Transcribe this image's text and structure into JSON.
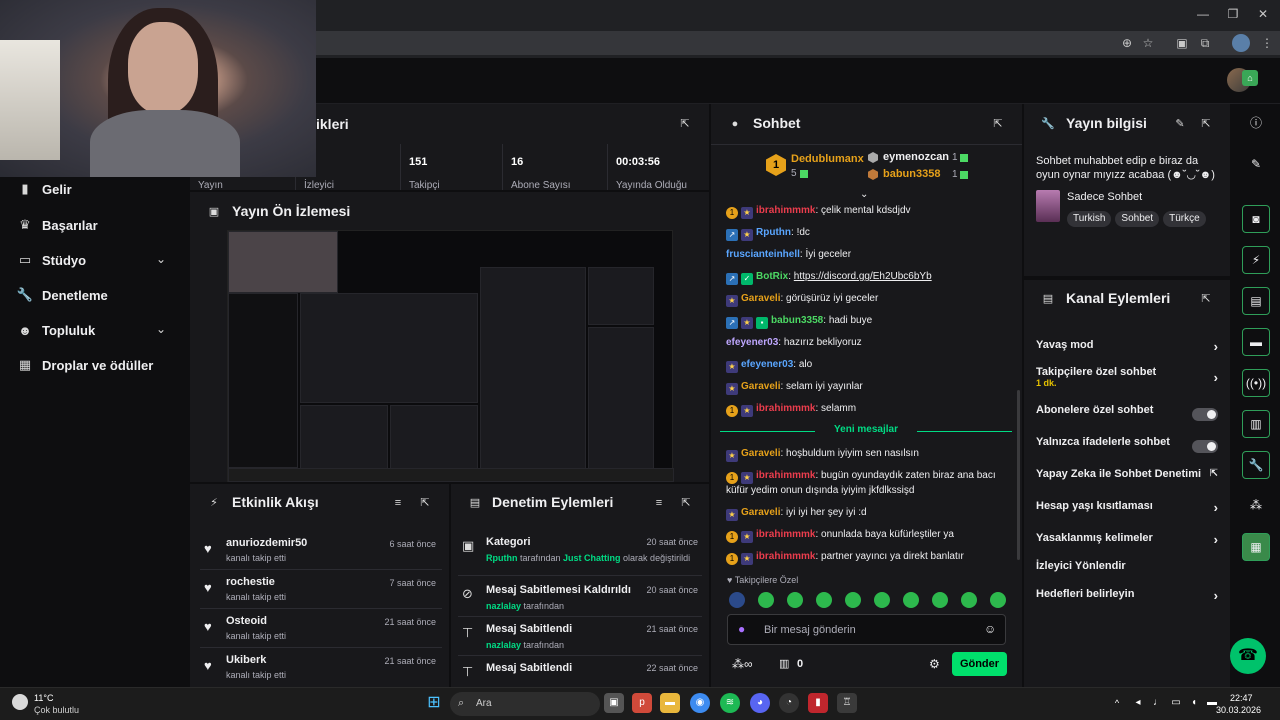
{
  "browser": {
    "title": ""
  },
  "sidebar": {
    "items": [
      {
        "label": "Gelir",
        "icon": "revenue-icon"
      },
      {
        "label": "Başarılar",
        "icon": "trophy-icon"
      },
      {
        "label": "Stüdyo",
        "icon": "studio-icon"
      },
      {
        "label": "Denetleme",
        "icon": "wrench-icon"
      },
      {
        "label": "Topluluk",
        "icon": "people-icon"
      },
      {
        "label": "Droplar ve ödüller",
        "icon": "gift-icon"
      }
    ]
  },
  "stats": {
    "header": "ikleri",
    "cells": [
      {
        "num": "",
        "label": "Yayın"
      },
      {
        "num": "",
        "label": "İzleyici"
      },
      {
        "num": "151",
        "label": "Takipçi"
      },
      {
        "num": "16",
        "label": "Abone Sayısı"
      },
      {
        "num": "00:03:56",
        "label": "Yayında Olduğu"
      }
    ]
  },
  "preview": {
    "title": "Yayın Ön İzlemesi"
  },
  "activity": {
    "title": "Etkinlik Akışı",
    "rows": [
      {
        "name": "anuriozdemir50",
        "sub": "kanalı takip etti",
        "time": "6 saat önce"
      },
      {
        "name": "rochestie",
        "sub": "kanalı takip etti",
        "time": "7 saat önce"
      },
      {
        "name": "Osteoid",
        "sub": "kanalı takip etti",
        "time": "21 saat önce"
      },
      {
        "name": "Ukiberk",
        "sub": "kanalı takip etti",
        "time": "21 saat önce"
      }
    ]
  },
  "moderation": {
    "title": "Denetim Eylemleri",
    "rows": [
      {
        "title": "Kategori",
        "time": "20 saat önce",
        "user": "Rputhn",
        "mid": " tarafından ",
        "extra": "Just Chatting",
        "tail": " olarak değiştirildi"
      },
      {
        "title": "Mesaj Sabitlemesi Kaldırıldı",
        "time": "20 saat önce",
        "user": "nazlalay",
        "mid": " tarafından",
        "extra": "",
        "tail": ""
      },
      {
        "title": "Mesaj Sabitlendi",
        "time": "21 saat önce",
        "user": "nazlalay",
        "mid": " tarafından",
        "extra": "",
        "tail": ""
      },
      {
        "title": "Mesaj Sabitlendi",
        "time": "22 saat önce",
        "user": "",
        "mid": "",
        "extra": "",
        "tail": ""
      }
    ]
  },
  "chat": {
    "title": "Sohbet",
    "leader1": {
      "name": "Dedublumanx",
      "count": "5"
    },
    "leader2": {
      "name": "eymenozcan",
      "count": "1"
    },
    "leader3": {
      "name": "babun3358",
      "count": "1"
    },
    "rank": "1",
    "lines": [
      {
        "user": "ibrahimmmk",
        "msg": "çelik mental kdsdjdv"
      },
      {
        "user": "Rputhn",
        "msg": "!dc"
      },
      {
        "user": "fruscianteinhell",
        "msg": "İyi geceler"
      },
      {
        "user": "BotRix",
        "msg": "https://discord.gg/Eh2Ubc6bYb"
      },
      {
        "user": "Garaveli",
        "msg": "görüşürüz iyi geceler"
      },
      {
        "user": "babun3358",
        "msg": "hadi buye"
      },
      {
        "user": "efeyener03",
        "msg": "hazırız bekliyoruz"
      },
      {
        "user": "efeyener03",
        "msg": "alo"
      },
      {
        "user": "Garaveli",
        "msg": "selam iyi yayınlar"
      },
      {
        "user": "ibrahimmmk",
        "msg": "selamm"
      },
      {
        "user": "Garaveli",
        "msg": "hoşbuldum iyiyim sen nasılsın"
      },
      {
        "user": "ibrahimmmk",
        "msg": "bugün oyundaydık zaten biraz ana bacı küfür yedim onun dışında iyiyim jkfdlkssişd"
      },
      {
        "user": "Garaveli",
        "msg": "iyi iyi her şey iyi :d"
      },
      {
        "user": "ibrahimmmk",
        "msg": "onunlada baya küfürleştiler ya"
      },
      {
        "user": "ibrahimmmk",
        "msg": "partner yayıncı ya direkt banlatır"
      }
    ],
    "new_messages": "Yeni mesajlar",
    "followers_only": "Takipçilere Özel",
    "input_placeholder": "Bir mesaj gönderin",
    "send": "Gönder",
    "viewer_count": "0"
  },
  "streaminfo": {
    "title": "Yayın bilgisi",
    "desc": "Sohbet muhabbet edip e biraz da oyun oynar mıyızz acabaa (☻˘◡˘☻)",
    "category": "Sadece Sohbet",
    "tags": [
      "Turkish",
      "Sohbet",
      "Türkçe"
    ]
  },
  "channel_actions": {
    "title": "Kanal Eylemleri",
    "rows": [
      {
        "label": "Yavaş mod",
        "sub": "",
        "kind": "chevron"
      },
      {
        "label": "Takipçilere özel sohbet",
        "sub": "1 dk.",
        "kind": "chevron"
      },
      {
        "label": "Abonelere özel sohbet",
        "sub": "",
        "kind": "toggle"
      },
      {
        "label": "Yalnızca ifadelerle sohbet",
        "sub": "",
        "kind": "toggle"
      },
      {
        "label": "Yapay Zeka ile Sohbet Denetimi",
        "sub": "",
        "kind": "external"
      },
      {
        "label": "Hesap yaşı kısıtlaması",
        "sub": "",
        "kind": "chevron"
      },
      {
        "label": "Yasaklanmış kelimeler",
        "sub": "",
        "kind": "chevron"
      },
      {
        "label": "İzleyici Yönlendir",
        "sub": "",
        "kind": "none"
      },
      {
        "label": "Hedefleri belirleyin",
        "sub": "",
        "kind": "chevron"
      }
    ]
  },
  "taskbar": {
    "weather_temp": "11°C",
    "weather_desc": "Çok bulutlu",
    "search": "Ara",
    "time": "22:47",
    "date": "30.03.2026"
  },
  "colors": {
    "accent": "#00e06c",
    "panel": "#18181b",
    "bg": "#0e0e10"
  }
}
